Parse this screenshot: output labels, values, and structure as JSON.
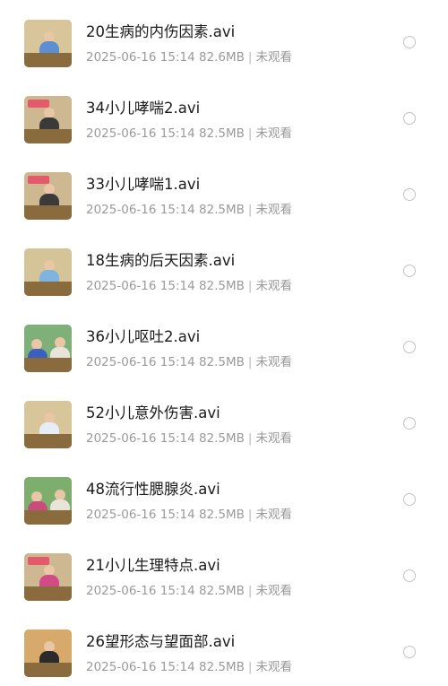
{
  "files": [
    {
      "name": "20生病的内伤因素.avi",
      "date": "2025-06-16 15:14",
      "size": "82.6MB",
      "status": "未观看",
      "thumb": {
        "bg": "#d8c69a",
        "shirt": "#5b8fd1",
        "variant": "man"
      }
    },
    {
      "name": "34小儿哮喘2.avi",
      "date": "2025-06-16 15:14",
      "size": "82.5MB",
      "status": "未观看",
      "thumb": {
        "bg": "#cdb891",
        "shirt": "#3a3a3a",
        "variant": "woman-sign"
      }
    },
    {
      "name": "33小儿哮喘1.avi",
      "date": "2025-06-16 15:14",
      "size": "82.5MB",
      "status": "未观看",
      "thumb": {
        "bg": "#cdb891",
        "shirt": "#3a3a3a",
        "variant": "woman-sign"
      }
    },
    {
      "name": "18生病的后天因素.avi",
      "date": "2025-06-16 15:14",
      "size": "82.5MB",
      "status": "未观看",
      "thumb": {
        "bg": "#d4c497",
        "shirt": "#7fb3e0",
        "variant": "man"
      }
    },
    {
      "name": "36小儿呕吐2.avi",
      "date": "2025-06-16 15:14",
      "size": "82.5MB",
      "status": "未观看",
      "thumb": {
        "bg": "#7fb07a",
        "shirt": "#3b5fbf",
        "variant": "group"
      }
    },
    {
      "name": "52小儿意外伤害.avi",
      "date": "2025-06-16 15:14",
      "size": "82.5MB",
      "status": "未观看",
      "thumb": {
        "bg": "#d8c69a",
        "shirt": "#e6edf5",
        "variant": "man"
      }
    },
    {
      "name": "48流行性腮腺炎.avi",
      "date": "2025-06-16 15:14",
      "size": "82.5MB",
      "status": "未观看",
      "thumb": {
        "bg": "#7eae6e",
        "shirt": "#c94c7a",
        "variant": "group"
      }
    },
    {
      "name": "21小儿生理特点.avi",
      "date": "2025-06-16 15:14",
      "size": "82.5MB",
      "status": "未观看",
      "thumb": {
        "bg": "#cdb891",
        "shirt": "#d24a86",
        "variant": "woman-sign"
      }
    },
    {
      "name": "26望形态与望面部.avi",
      "date": "2025-06-16 15:14",
      "size": "82.5MB",
      "status": "未观看",
      "thumb": {
        "bg": "#d7a96a",
        "shirt": "#2b2b2b",
        "variant": "woman"
      }
    }
  ],
  "icons": {
    "radio": "radio-unchecked-icon"
  },
  "colors": {
    "title": "#1a1a1a",
    "meta": "#9a9a9a",
    "radio_border": "#c4c4c4"
  }
}
